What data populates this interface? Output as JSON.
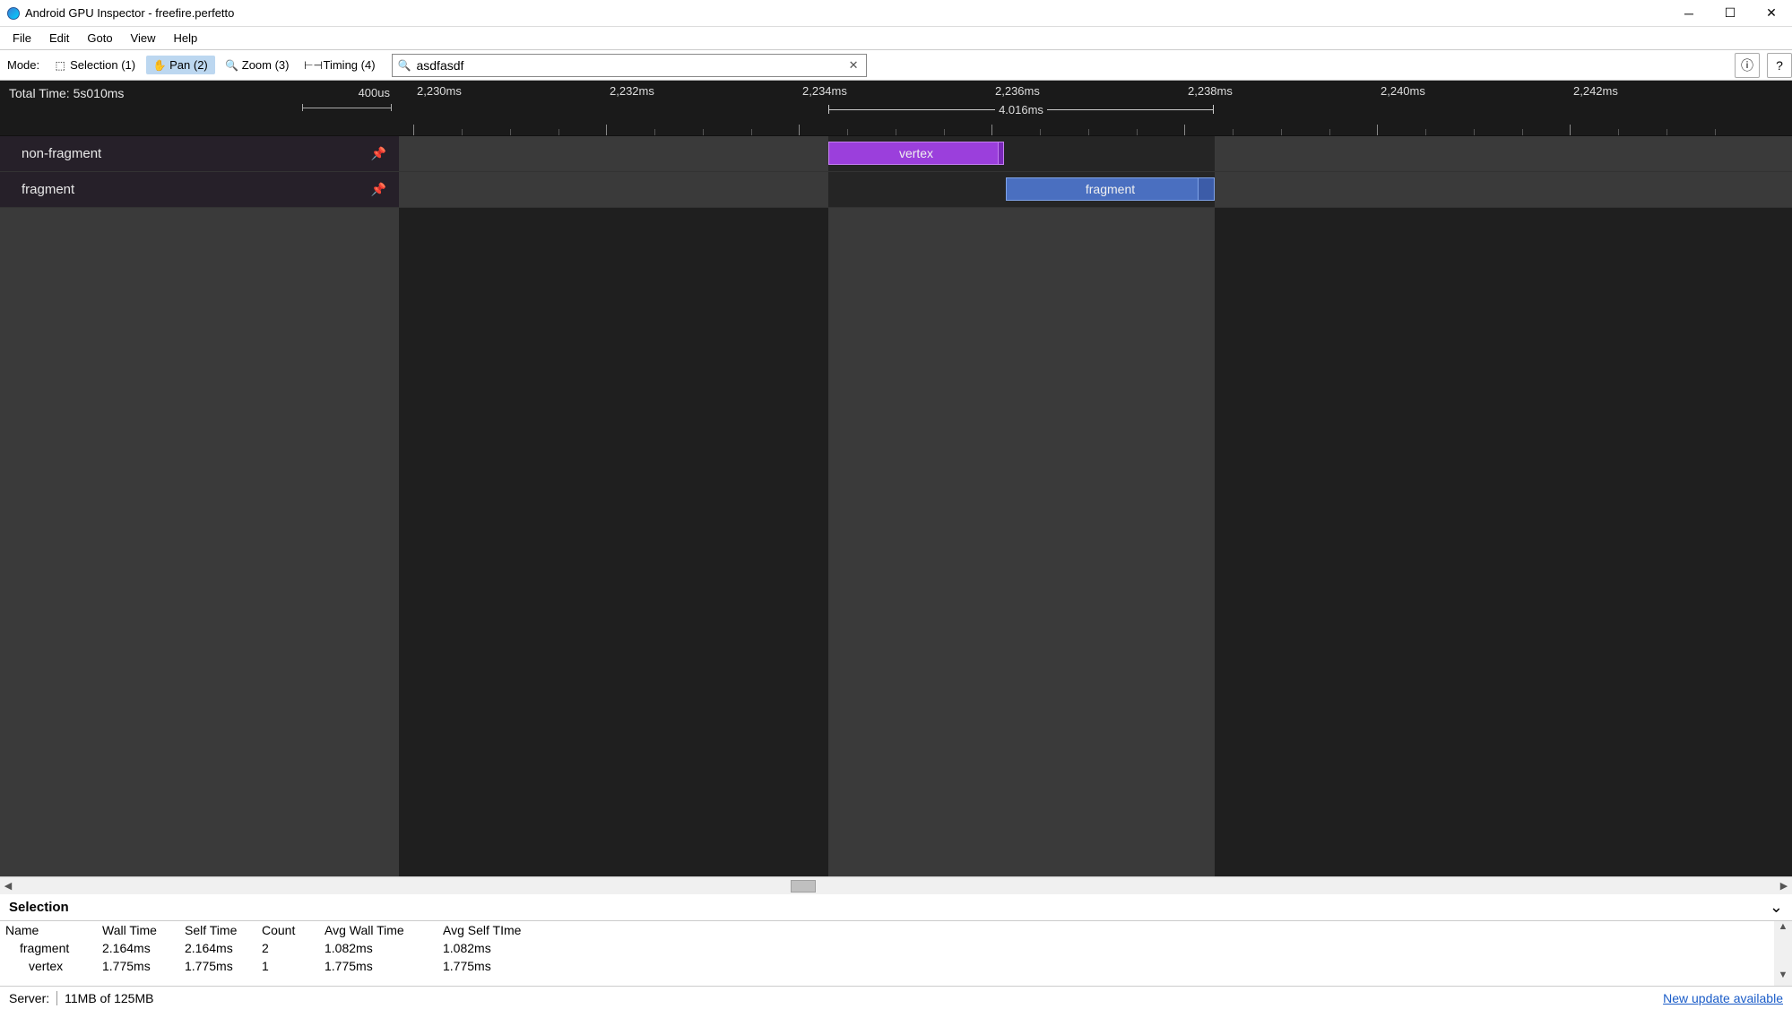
{
  "window": {
    "title": "Android GPU Inspector - freefire.perfetto"
  },
  "menu": {
    "file": "File",
    "edit": "Edit",
    "goto": "Goto",
    "view": "View",
    "help": "Help"
  },
  "toolbar": {
    "mode_label": "Mode:",
    "modes": {
      "selection": "Selection (1)",
      "pan": "Pan (2)",
      "zoom": "Zoom (3)",
      "timing": "Timing (4)"
    },
    "search_value": "asdfasdf"
  },
  "timeline": {
    "total_time_label": "Total Time: 5s010ms",
    "scale_label": "400us",
    "ruler_labels": [
      "2,230ms",
      "2,232ms",
      "2,234ms",
      "2,236ms",
      "2,238ms",
      "2,240ms",
      "2,242ms"
    ],
    "range_label": "4.016ms",
    "tracks": [
      {
        "label": "non-fragment"
      },
      {
        "label": "fragment"
      }
    ],
    "slices": {
      "vertex_label": "vertex",
      "fragment_label": "fragment"
    }
  },
  "selection": {
    "title": "Selection",
    "headers": {
      "name": "Name",
      "wall_time": "Wall Time",
      "self_time": "Self Time",
      "count": "Count",
      "avg_wall_time": "Avg Wall Time",
      "avg_self_time": "Avg Self TIme"
    },
    "rows": [
      {
        "name": "fragment",
        "wall_time": "2.164ms",
        "self_time": "2.164ms",
        "count": "2",
        "avg_wall": "1.082ms",
        "avg_self": "1.082ms"
      },
      {
        "name": "vertex",
        "wall_time": "1.775ms",
        "self_time": "1.775ms",
        "count": "1",
        "avg_wall": "1.775ms",
        "avg_self": "1.775ms"
      }
    ]
  },
  "status": {
    "server_label": "Server:",
    "server_mem": "11MB of 125MB",
    "update_link": "New update available"
  }
}
